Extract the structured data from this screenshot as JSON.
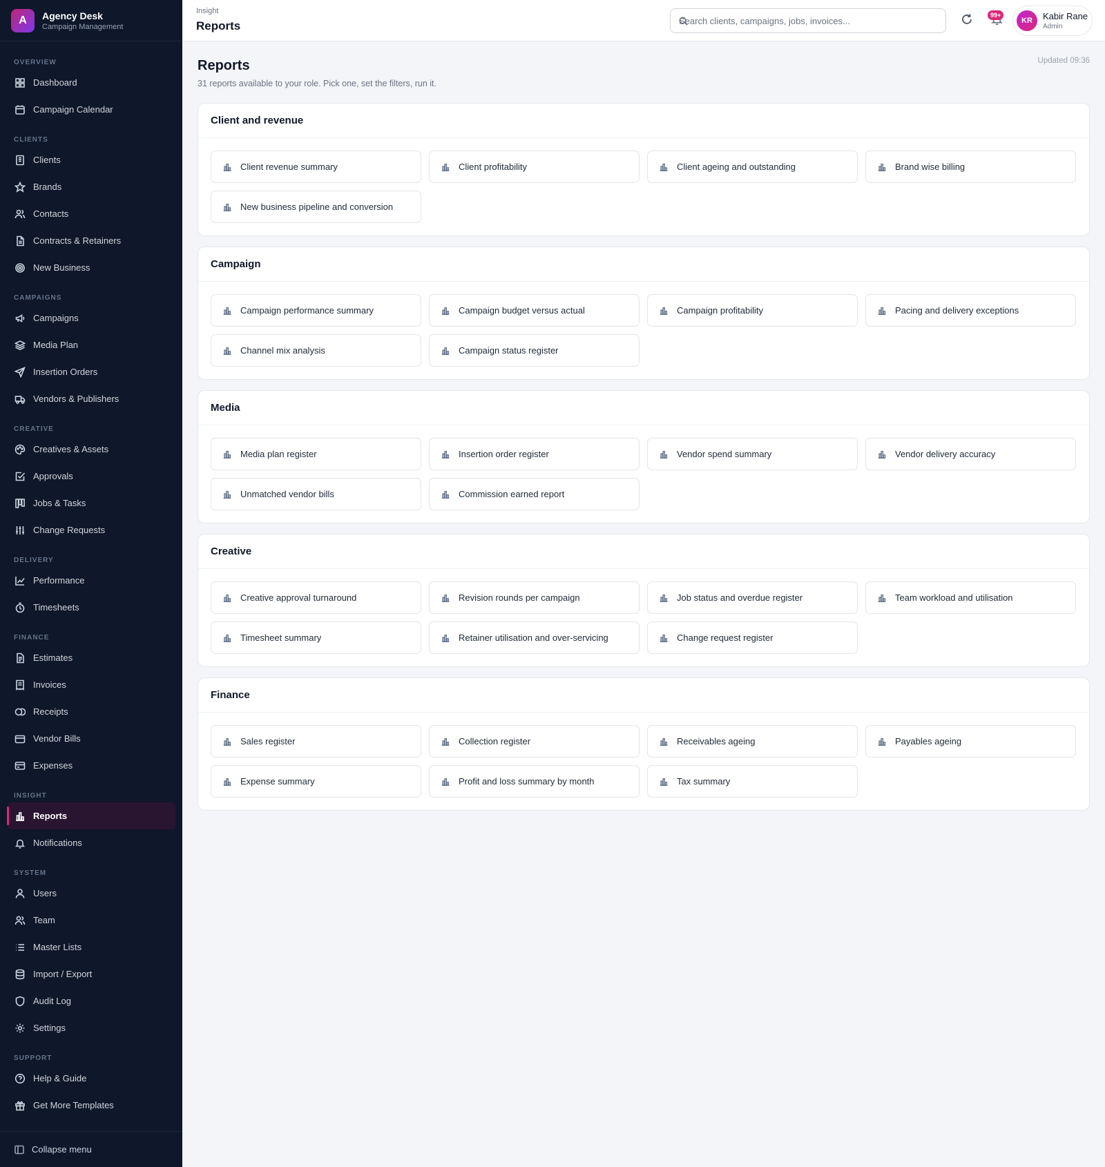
{
  "brand": {
    "logo_letter": "A",
    "name": "Agency Desk",
    "subtitle": "Campaign Management"
  },
  "sidebar": {
    "sections": [
      {
        "title": "OVERVIEW",
        "items": [
          {
            "label": "Dashboard",
            "icon": "grid-icon"
          },
          {
            "label": "Campaign Calendar",
            "icon": "calendar-icon"
          }
        ]
      },
      {
        "title": "CLIENTS",
        "items": [
          {
            "label": "Clients",
            "icon": "building-icon"
          },
          {
            "label": "Brands",
            "icon": "star-icon"
          },
          {
            "label": "Contacts",
            "icon": "users-icon"
          },
          {
            "label": "Contracts & Retainers",
            "icon": "file-icon"
          },
          {
            "label": "New Business",
            "icon": "target-icon"
          }
        ]
      },
      {
        "title": "CAMPAIGNS",
        "items": [
          {
            "label": "Campaigns",
            "icon": "megaphone-icon"
          },
          {
            "label": "Media Plan",
            "icon": "layers-icon"
          },
          {
            "label": "Insertion Orders",
            "icon": "send-icon"
          },
          {
            "label": "Vendors & Publishers",
            "icon": "truck-icon"
          }
        ]
      },
      {
        "title": "CREATIVE",
        "items": [
          {
            "label": "Creatives & Assets",
            "icon": "palette-icon"
          },
          {
            "label": "Approvals",
            "icon": "check-square-icon"
          },
          {
            "label": "Jobs & Tasks",
            "icon": "kanban-icon"
          },
          {
            "label": "Change Requests",
            "icon": "sliders-icon"
          }
        ]
      },
      {
        "title": "DELIVERY",
        "items": [
          {
            "label": "Performance",
            "icon": "line-chart-icon"
          },
          {
            "label": "Timesheets",
            "icon": "timer-icon"
          }
        ]
      },
      {
        "title": "FINANCE",
        "items": [
          {
            "label": "Estimates",
            "icon": "file-text-icon"
          },
          {
            "label": "Invoices",
            "icon": "receipt-icon"
          },
          {
            "label": "Receipts",
            "icon": "coins-icon"
          },
          {
            "label": "Vendor Bills",
            "icon": "wallet-icon"
          },
          {
            "label": "Expenses",
            "icon": "card-icon"
          }
        ]
      },
      {
        "title": "INSIGHT",
        "items": [
          {
            "label": "Reports",
            "icon": "bar-chart-icon",
            "active": true
          },
          {
            "label": "Notifications",
            "icon": "bell-icon"
          }
        ]
      },
      {
        "title": "SYSTEM",
        "items": [
          {
            "label": "Users",
            "icon": "user-icon"
          },
          {
            "label": "Team",
            "icon": "users-icon"
          },
          {
            "label": "Master Lists",
            "icon": "list-icon"
          },
          {
            "label": "Import / Export",
            "icon": "database-icon"
          },
          {
            "label": "Audit Log",
            "icon": "shield-icon"
          },
          {
            "label": "Settings",
            "icon": "gear-icon"
          }
        ]
      },
      {
        "title": "SUPPORT",
        "items": [
          {
            "label": "Help & Guide",
            "icon": "help-circle-icon"
          },
          {
            "label": "Get More Templates",
            "icon": "gift-icon"
          }
        ]
      }
    ],
    "collapse_label": "Collapse menu"
  },
  "topbar": {
    "breadcrumb": "Insight",
    "title": "Reports",
    "search_placeholder": "Search clients, campaigns, jobs, invoices...",
    "notification_badge": "99+",
    "user": {
      "initials": "KR",
      "name": "Kabir Rane",
      "role": "Admin"
    }
  },
  "page": {
    "title": "Reports",
    "subtitle": "31 reports available to your role. Pick one, set the filters, run it.",
    "updated": "Updated 09:36"
  },
  "groups": [
    {
      "title": "Client and revenue",
      "reports": [
        "Client revenue summary",
        "Client profitability",
        "Client ageing and outstanding",
        "Brand wise billing",
        "New business pipeline and conversion"
      ]
    },
    {
      "title": "Campaign",
      "reports": [
        "Campaign performance summary",
        "Campaign budget versus actual",
        "Campaign profitability",
        "Pacing and delivery exceptions",
        "Channel mix analysis",
        "Campaign status register"
      ]
    },
    {
      "title": "Media",
      "reports": [
        "Media plan register",
        "Insertion order register",
        "Vendor spend summary",
        "Vendor delivery accuracy",
        "Unmatched vendor bills",
        "Commission earned report"
      ]
    },
    {
      "title": "Creative",
      "reports": [
        "Creative approval turnaround",
        "Revision rounds per campaign",
        "Job status and overdue register",
        "Team workload and utilisation",
        "Timesheet summary",
        "Retainer utilisation and over-servicing",
        "Change request register"
      ]
    },
    {
      "title": "Finance",
      "reports": [
        "Sales register",
        "Collection register",
        "Receivables ageing",
        "Payables ageing",
        "Expense summary",
        "Profit and loss summary by month",
        "Tax summary"
      ]
    }
  ],
  "colors": {
    "sidebar_bg": "#0f172a",
    "accent": "#db2777",
    "page_bg": "#f4f5f9"
  }
}
